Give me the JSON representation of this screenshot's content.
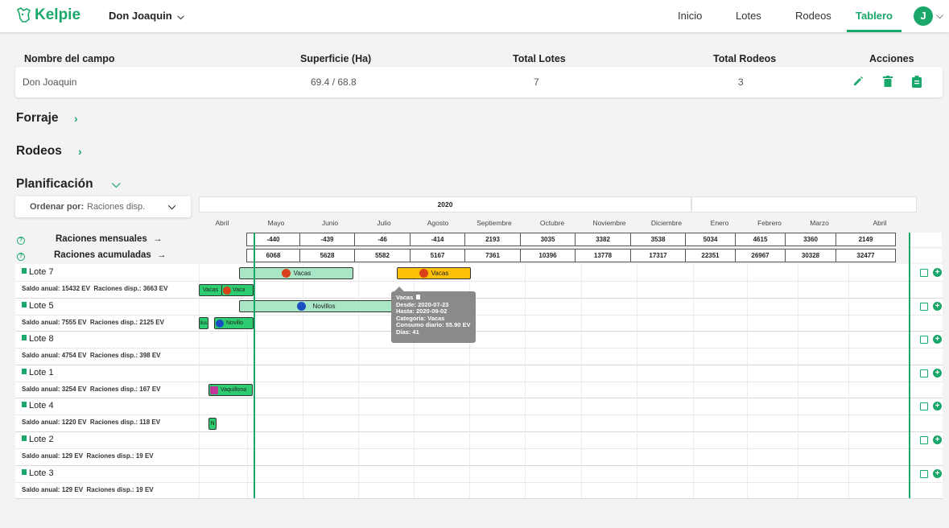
{
  "brand": {
    "name": "Kelpie"
  },
  "farm_selector": {
    "value": "Don Joaquin"
  },
  "nav": [
    "Inicio",
    "Lotes",
    "Rodeos",
    "Tablero"
  ],
  "user": {
    "initial": "J"
  },
  "summary": {
    "headers": {
      "name": "Nombre del campo",
      "area": "Superficie (Ha)",
      "lots": "Total Lotes",
      "herds": "Total Rodeos",
      "actions": "Acciones"
    },
    "row": {
      "name": "Don Joaquin",
      "area": "69.4 / 68.8",
      "lots": "7",
      "herds": "3"
    }
  },
  "sections": {
    "forage": "Forraje",
    "herds": "Rodeos",
    "planning": "Planificación"
  },
  "sort": {
    "label": "Ordenar por:",
    "value": "Raciones disp."
  },
  "year": "2020",
  "months": [
    "Abril",
    "Mayo",
    "Junio",
    "Julio",
    "Agosto",
    "Septiembre",
    "Octubre",
    "Noviembre",
    "Diciembre",
    "Enero",
    "Febrero",
    "Marzo",
    "Abril"
  ],
  "metrics": [
    {
      "label": "Raciones mensuales",
      "arrow": "→",
      "values": [
        "-440",
        "-439",
        "-46",
        "-414",
        "2193",
        "3035",
        "3382",
        "3538",
        "5034",
        "4615",
        "3360",
        "2149"
      ]
    },
    {
      "label": "Raciones acumuladas",
      "arrow": "→",
      "values": [
        "6068",
        "5628",
        "5582",
        "5167",
        "7361",
        "10396",
        "13778",
        "17317",
        "22351",
        "26967",
        "30328",
        "32477"
      ]
    }
  ],
  "lots": [
    {
      "name": "Lote 7",
      "sub": "Saldo anual: 15432 EV  Raciones disp.: 3663 EV"
    },
    {
      "name": "Lote 5",
      "sub": "Saldo anual: 7555 EV  Raciones disp.: 2125 EV"
    },
    {
      "name": "Lote 8",
      "sub": "Saldo anual: 4754 EV  Raciones disp.: 398 EV"
    },
    {
      "name": "Lote 1",
      "sub": "Saldo anual: 3254 EV  Raciones disp.: 167 EV"
    },
    {
      "name": "Lote 4",
      "sub": "Saldo anual: 1220 EV  Raciones disp.: 118 EV"
    },
    {
      "name": "Lote 2",
      "sub": "Saldo anual: 129 EV  Raciones disp.: 19 EV"
    },
    {
      "name": "Lote 3",
      "sub": "Saldo anual: 129 EV  Raciones disp.: 19 EV"
    }
  ],
  "bars": {
    "lot7_a": "Vacas",
    "lot7_b": "Vacas",
    "lot7_small1": "Vacas",
    "lot7_small2": "Vaca",
    "lot5_a": "Novillos",
    "lot5_small1": "llos",
    "lot5_small2": "Novillo",
    "lot1_a": "Vaquillona",
    "lot4_a": "N"
  },
  "tooltip": {
    "title": "Vacas",
    "from": "Desde: 2020-07-23",
    "to": "Hasta: 2020-09-02",
    "category": "Categoría: Vacas",
    "consumption": "Consumo diario: 55.90 EV",
    "days": "Días: 41"
  },
  "colors": {
    "accent": "#1aa86a",
    "bar_green": "#a8e6c6",
    "bar_orange": "#ffc107",
    "bar_dark_green": "#2ecc71",
    "icon_red": "#d9401c",
    "icon_blue": "#1a4fc4",
    "icon_pink": "#c2369a"
  }
}
